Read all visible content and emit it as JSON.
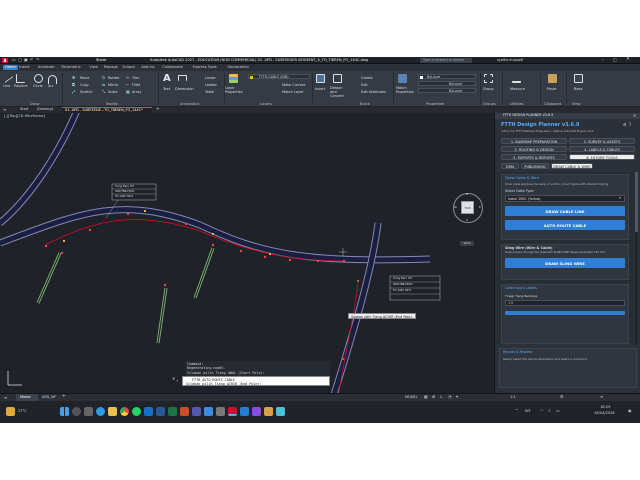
{
  "title_bar": {
    "quick_title": "Share",
    "window_title": "Autodesk AutoCAD 2027 - EDUCATION (NON COMMERCIAL) 01. APD - SUBFEEDER SEGMENT_4_TO_TIBREN_FO_144C.dwg",
    "search_placeholder": "Type a keyword or phrase",
    "user": "syaiful.muadzit"
  },
  "ribbon_tabs": [
    "Home",
    "Insert",
    "Annotate",
    "Parametric",
    "View",
    "Manage",
    "Output",
    "Add-ins",
    "Collaborate",
    "Express Tools",
    "Geolocation"
  ],
  "ribbon_active_tab": "Home",
  "ribbon": {
    "draw": {
      "label": "Draw",
      "tools": [
        "Line",
        "Polyline",
        "Circle",
        "Arc"
      ]
    },
    "modify": {
      "label": "Modify",
      "tools": [
        "Move",
        "Rotate",
        "Trim",
        "Copy",
        "Mirror",
        "Fillet",
        "Stretch",
        "Scale",
        "Array"
      ]
    },
    "annotation": {
      "label": "Annotation",
      "tools": [
        "Text",
        "Dimension",
        "Linear",
        "Leader",
        "Table"
      ]
    },
    "layers": {
      "label": "Layers",
      "tools": [
        "Layer Properties",
        "Make Current",
        "Match Layer"
      ],
      "current_layer": "FTTH-CABLE (BIN)"
    },
    "block": {
      "label": "Block",
      "tools": [
        "Insert",
        "Create",
        "Edit",
        "Edit Attributes"
      ]
    },
    "block_tools": [
      "Detach and Convert"
    ],
    "properties": {
      "label": "Properties",
      "tools": [
        "Match Properties"
      ],
      "bylayer": [
        "ByLayer",
        "ByLayer",
        "ByLayer"
      ]
    },
    "groups": {
      "label": "Groups",
      "tools": [
        "Group"
      ]
    },
    "utilities": {
      "label": "Utilities",
      "tools": [
        "Measure"
      ]
    },
    "clipboard": {
      "label": "Clipboard",
      "tools": [
        "Paste"
      ]
    },
    "view": {
      "label": "View",
      "tools": [
        "Base"
      ]
    }
  },
  "doc_tabs": [
    "Start",
    "Drawing1",
    "01. APD - SUBFEEDE...TO_TIBREN_FO_144C*"
  ],
  "viewport_label": "[-][Top][2D Wireframe]",
  "viewcube": {
    "face": "TOP",
    "n": "N",
    "s": "S",
    "e": "E",
    "w": "W",
    "wcs": "WCS"
  },
  "tooltip": "Silakan pilih Tiang ACHIR (End Pole):",
  "pole_boxes": [
    [
      "Tiang Baru 7M",
      "ODP-TBR-FZ/01",
      "FO 144C SKYL"
    ],
    [
      "Tiang Baru 7M",
      "ODP-TBR-FZ/02",
      "FO 144C SKYL"
    ]
  ],
  "command": {
    "title": "Command:",
    "history": [
      "Command:",
      "Regenerating model.",
      "Silakan pilih Tiang AWAL (Start Pole):"
    ],
    "input_tool": "FTTH_AUTO_ROUTE_CABLE",
    "prompt": "Silakan pilih Tiang ACHIR (End Pole):"
  },
  "palette": {
    "header": "FTTH DESIGN PLANNER V3.6.9",
    "title": "FTTH Design Planner v3.6.9",
    "subtitle": "Add-in for FTTH Network Engineers • Native AutoCAD Engine v4.0",
    "main_tabs": [
      "1. BASEMAP PREPARATION",
      "2. SURVEY & ASSETS",
      "3. ROUTING & DESIGN",
      "4. LABELS & TABLES",
      "5. EXPORTS & REPORTS",
      "6. FUTURE TOOLS"
    ],
    "sub_tabs": [
      "DRM",
      "PUBLISHING",
      "DRAW CABLE & WIRE"
    ],
    "draw_section": {
      "title": "Draw Cable & Wire",
      "desc": "Draw cable polylines manually or via the correct layers with standard styling.",
      "select_label": "Select Cable Type:",
      "select_value": "Kabel 288C (Yellow)",
      "btn_draw": "DRAW CABLE LINE",
      "btn_auto": "AUTO ROUTE CABLE"
    },
    "sling_section": {
      "title": "Sling Wire (Wire & Cable)",
      "desc": "Draw polyline through the poles with SLING WIRE design parameter 100 mm.",
      "btn": "DRAW SLING WIRE"
    },
    "sag_section": {
      "title": "Cable Sag & Labels",
      "height_label": "Tinggi Tiang Bentang:",
      "height_value": "1.5"
    },
    "results": {
      "title": "Results & Reports",
      "text": "Ready: select the layout parameters and select a command."
    }
  },
  "status": {
    "tabs": [
      "Model",
      "APD_MF"
    ],
    "right": [
      "MODEL"
    ],
    "scale": "1:1"
  },
  "taskbar": {
    "lang": "INT",
    "time": "18:29",
    "date": "16/04/2026",
    "temp": "27°C"
  },
  "colors": {
    "canvas": "#1f2329",
    "accent": "#2f7fd6",
    "road_fill": "#1a1f3f",
    "road_edge": "#8787b5",
    "cable": "#d01020",
    "green_path": "#7fb870"
  }
}
